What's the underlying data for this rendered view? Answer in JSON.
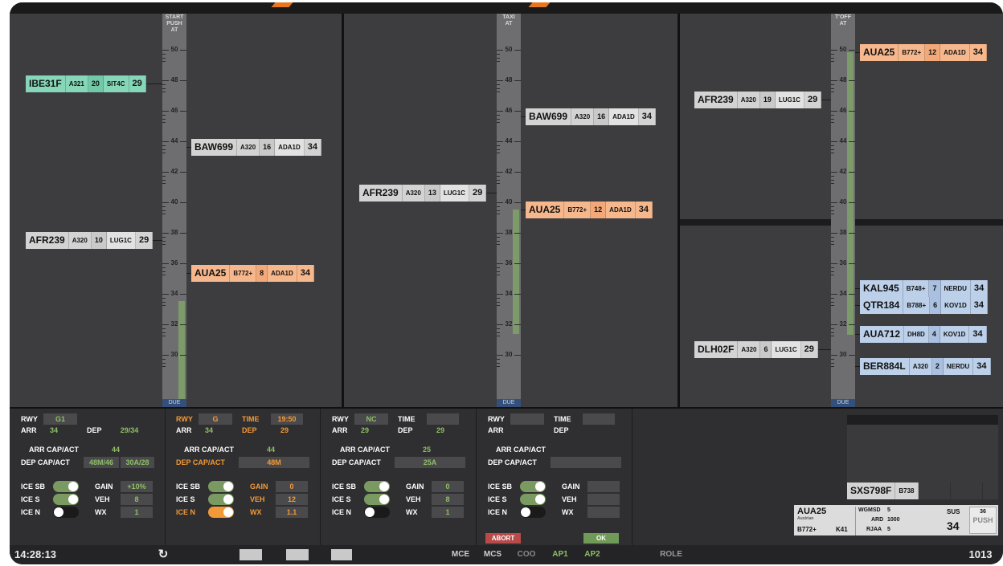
{
  "panels": [
    {
      "ruler_label": "START\nPUSH\nAT",
      "ticks": [
        "50",
        "48",
        "46",
        "44",
        "42",
        "40",
        "38",
        "36",
        "34",
        "32",
        "30"
      ],
      "due": "DUE",
      "left_strips": [
        {
          "callsign": "IBE31F",
          "type": "A321",
          "slot": "20",
          "sid": "SIT4C",
          "rwy": "29",
          "color": "green"
        },
        {
          "callsign": "AFR239",
          "type": "A320",
          "slot": "10",
          "sid": "LUG1C",
          "rwy": "29",
          "color": "gray"
        }
      ],
      "right_strips": [
        {
          "callsign": "BAW699",
          "type": "A320",
          "slot": "16",
          "sid": "ADA1D",
          "rwy": "34",
          "color": "gray"
        },
        {
          "callsign": "AUA25",
          "type": "B772+",
          "slot": "8",
          "sid": "ADA1D",
          "rwy": "34",
          "color": "orange"
        }
      ]
    },
    {
      "ruler_label": "TAXI\nAT",
      "ticks": [
        "50",
        "48",
        "46",
        "44",
        "42",
        "40",
        "38",
        "36",
        "34",
        "32",
        "30"
      ],
      "due": "DUE",
      "left_strips": [
        {
          "callsign": "AFR239",
          "type": "A320",
          "slot": "13",
          "sid": "LUG1C",
          "rwy": "29",
          "color": "gray"
        }
      ],
      "right_strips": [
        {
          "callsign": "BAW699",
          "type": "A320",
          "slot": "16",
          "sid": "ADA1D",
          "rwy": "34",
          "color": "gray"
        },
        {
          "callsign": "AUA25",
          "type": "B772+",
          "slot": "12",
          "sid": "ADA1D",
          "rwy": "34",
          "color": "orange"
        }
      ]
    },
    {
      "ruler_label": "T'OFF\nAT",
      "ticks": [
        "50",
        "48",
        "46",
        "44",
        "42",
        "40",
        "38",
        "36",
        "34",
        "32",
        "30"
      ],
      "due": "DUE",
      "left_strips": [
        {
          "callsign": "AFR239",
          "type": "A320",
          "slot": "19",
          "sid": "LUG1C",
          "rwy": "29",
          "color": "gray"
        },
        {
          "callsign": "DLH02F",
          "type": "A320",
          "slot": "6",
          "sid": "LUG1C",
          "rwy": "29",
          "color": "gray"
        }
      ],
      "right_strips": [
        {
          "callsign": "AUA25",
          "type": "B772+",
          "slot": "12",
          "sid": "ADA1D",
          "rwy": "34",
          "color": "orange"
        },
        {
          "callsign": "KAL945",
          "type": "B748+",
          "slot": "7",
          "sid": "NERDU",
          "rwy": "34",
          "color": "blue"
        },
        {
          "callsign": "QTR184",
          "type": "B788+",
          "slot": "6",
          "sid": "KOV1D",
          "rwy": "34",
          "color": "blue"
        },
        {
          "callsign": "AUA712",
          "type": "DH8D",
          "slot": "4",
          "sid": "KOV1D",
          "rwy": "34",
          "color": "blue"
        },
        {
          "callsign": "BER884L",
          "type": "A320",
          "slot": "2",
          "sid": "NERDU",
          "rwy": "34",
          "color": "blue"
        }
      ]
    }
  ],
  "config_columns": [
    {
      "rwy_label": "RWY",
      "rwy": "G1",
      "time_label": "",
      "time": "",
      "arr_label": "ARR",
      "arr": "34",
      "dep_label": "DEP",
      "dep": "29/34",
      "arr_cap_label": "ARR CAP/ACT",
      "arr_cap": "44",
      "dep_cap_label": "DEP CAP/ACT",
      "dep_cap": "48M/46",
      "dep_cap2": "30A/28",
      "ice_sb": "ICE SB",
      "ice_s": "ICE S",
      "ice_n": "ICE N",
      "gain_label": "GAIN",
      "gain": "+10%",
      "veh_label": "VEH",
      "veh": "8",
      "wx_label": "WX",
      "wx": "1"
    },
    {
      "rwy_label": "RWY",
      "rwy": "G",
      "time_label": "TIME",
      "time": "19:50",
      "arr_label": "ARR",
      "arr": "34",
      "dep_label": "DEP",
      "dep": "29",
      "arr_cap_label": "ARR CAP/ACT",
      "arr_cap": "44",
      "dep_cap_label": "DEP CAP/ACT",
      "dep_cap": "48M",
      "dep_cap2": "",
      "ice_sb": "ICE SB",
      "ice_s": "ICE S",
      "ice_n": "ICE N",
      "gain_label": "GAIN",
      "gain": "0",
      "veh_label": "VEH",
      "veh": "12",
      "wx_label": "WX",
      "wx": "1.1"
    },
    {
      "rwy_label": "RWY",
      "rwy": "NC",
      "time_label": "TIME",
      "time": "",
      "arr_label": "ARR",
      "arr": "29",
      "dep_label": "DEP",
      "dep": "29",
      "arr_cap_label": "ARR CAP/ACT",
      "arr_cap": "25",
      "dep_cap_label": "DEP CAP/ACT",
      "dep_cap": "25A",
      "dep_cap2": "",
      "ice_sb": "ICE SB",
      "ice_s": "ICE S",
      "ice_n": "ICE N",
      "gain_label": "GAIN",
      "gain": "0",
      "veh_label": "VEH",
      "veh": "8",
      "wx_label": "WX",
      "wx": "1"
    },
    {
      "rwy_label": "RWY",
      "rwy": "",
      "time_label": "TIME",
      "time": "",
      "arr_label": "ARR",
      "arr": "",
      "dep_label": "DEP",
      "dep": "",
      "arr_cap_label": "ARR CAP/ACT",
      "arr_cap": "",
      "dep_cap_label": "DEP CAP/ACT",
      "dep_cap": "",
      "dep_cap2": "",
      "ice_sb": "ICE SB",
      "ice_s": "ICE S",
      "ice_n": "ICE N",
      "gain_label": "GAIN",
      "gain": "",
      "veh_label": "VEH",
      "veh": "",
      "wx_label": "WX",
      "wx": ""
    }
  ],
  "actions": {
    "abort": "ABORT",
    "ok": "OK"
  },
  "side_strip": {
    "callsign": "SXS798F",
    "type": "B738"
  },
  "flight_card": {
    "callsign": "AUA25",
    "sub": "Austrian",
    "type": "B772+",
    "stand": "K41",
    "wgmsd_label": "WGMSD",
    "wgmsd": "5",
    "ard_label": "ARD",
    "ard": "1000",
    "rjaa_label": "RJAA",
    "rjaa": "5",
    "sus_label": "SUS",
    "rwy": "34",
    "push_num": "36",
    "push": "PUSH"
  },
  "statusbar": {
    "clock": "14:28:13",
    "undo_icon": "↻",
    "roles": [
      "MCE",
      "MCS",
      "COO",
      "AP1",
      "AP2"
    ],
    "role": "ROLE",
    "code": "1013"
  },
  "colors": {
    "accent": "#f39a38",
    "green": "#8fbf66",
    "strip_orange": "#f6b78c",
    "strip_green": "#86d6b9",
    "strip_blue": "#bcd0ea"
  }
}
